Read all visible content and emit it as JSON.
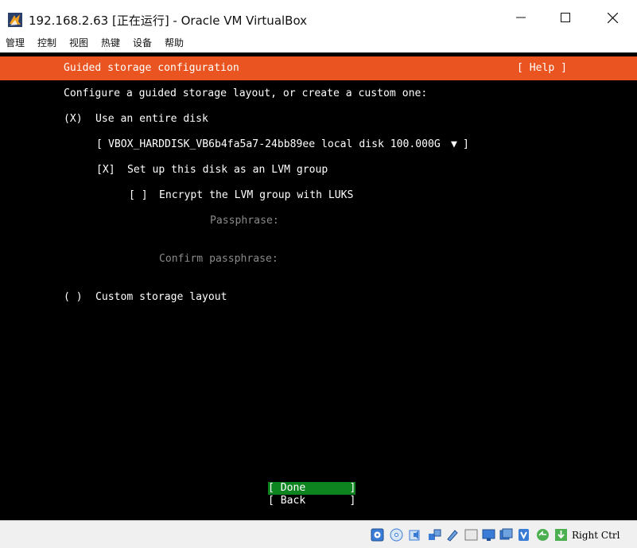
{
  "window": {
    "title": "192.168.2.63 [正在运行] - Oracle VM VirtualBox",
    "minimize_glyph": "—",
    "maximize_glyph": "☐",
    "close_glyph": "✕"
  },
  "menu": {
    "items": [
      "管理",
      "控制",
      "视图",
      "热键",
      "设备",
      "帮助"
    ]
  },
  "installer": {
    "header_title": "Guided storage configuration",
    "help_label": "[ Help ]",
    "intro": "Configure a guided storage layout, or create a custom one:",
    "entire_disk_radio": "(X)",
    "entire_disk_label": "Use an entire disk",
    "disk_select_open": "[",
    "disk_select_value": "VBOX_HARDDISK_VB6b4fa5a7-24bb89ee local disk 100.000G",
    "disk_select_arrow": "▼",
    "disk_select_close": "]",
    "lvm_checkbox": "[X]",
    "lvm_label": "Set up this disk as an LVM group",
    "encrypt_checkbox": "[ ]",
    "encrypt_label": "Encrypt the LVM group with LUKS",
    "passphrase_label": "Passphrase:",
    "confirm_passphrase_label": "Confirm passphrase:",
    "custom_radio": "( )",
    "custom_label": "Custom storage layout",
    "done_button": "[ Done       ]",
    "back_button": "[ Back       ]",
    "colors": {
      "header": "#e95420",
      "done": "#0e8420",
      "background": "#000000"
    }
  },
  "statusbar": {
    "icons": [
      "hard-disk-icon",
      "optical-drive-icon",
      "audio-icon",
      "network-icon",
      "usb-icon",
      "shared-folders-icon",
      "display-icon",
      "video-capture-icon",
      "virtualization-icon",
      "mouse-integration-icon",
      "keyboard-capture-icon"
    ],
    "host_key": "Right Ctrl"
  }
}
